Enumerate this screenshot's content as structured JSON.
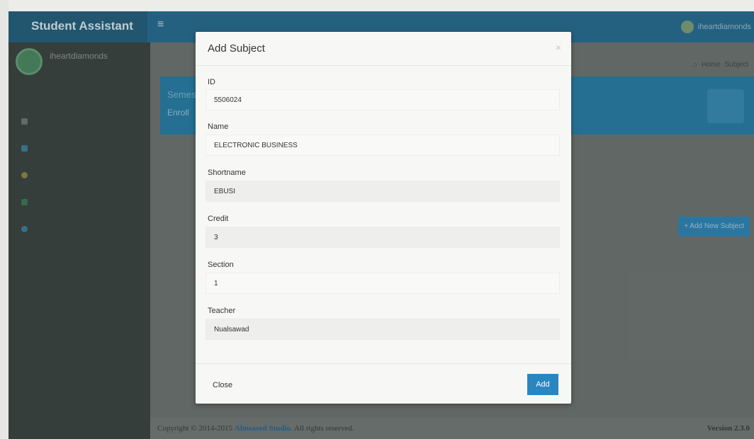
{
  "app": {
    "brand": "Student Assistant",
    "menu_toggle_glyph": "≡",
    "user_nav_name": "iheartdiamonds",
    "sidebar": {
      "user_name": "iheartdiamonds",
      "user_status": "",
      "header": "",
      "items": [
        {
          "label": "",
          "icon": "dashboard-icon"
        },
        {
          "label": "",
          "icon": "semester-icon"
        },
        {
          "label": "",
          "icon": "subject-icon"
        },
        {
          "label": "",
          "icon": "reporting-icon"
        },
        {
          "label": "",
          "icon": "signout-icon"
        }
      ]
    },
    "breadcrumb": {
      "home": "Home",
      "current": "Subject"
    },
    "info_box": {
      "title": "Semes",
      "subtitle": "Enroll"
    },
    "add_new_button": "+ Add New Subject",
    "footer": {
      "copyright_prefix": "Copyright © 2014-2015",
      "studio": "Almsaeed Studio.",
      "rights": "All rights reserved.",
      "version": "Version 2.3.0"
    }
  },
  "modal": {
    "title": "Add Subject",
    "close_glyph": "×",
    "fields": {
      "id": {
        "label": "ID",
        "value": "5506024"
      },
      "name": {
        "label": "Name",
        "value": "ELECTRONIC BUSINESS"
      },
      "shortname": {
        "label": "Shortname",
        "value": "EBUSI"
      },
      "credit": {
        "label": "Credit",
        "value": "3"
      },
      "section": {
        "label": "Section",
        "value": "1"
      },
      "teacher": {
        "label": "Teacher",
        "value": "Nualsawad"
      }
    },
    "close_button": "Close",
    "add_button": "Add"
  },
  "colors": {
    "navbar": "#2a6f93",
    "primary_button": "#2a86c1",
    "sidebar": "#3d4744"
  }
}
